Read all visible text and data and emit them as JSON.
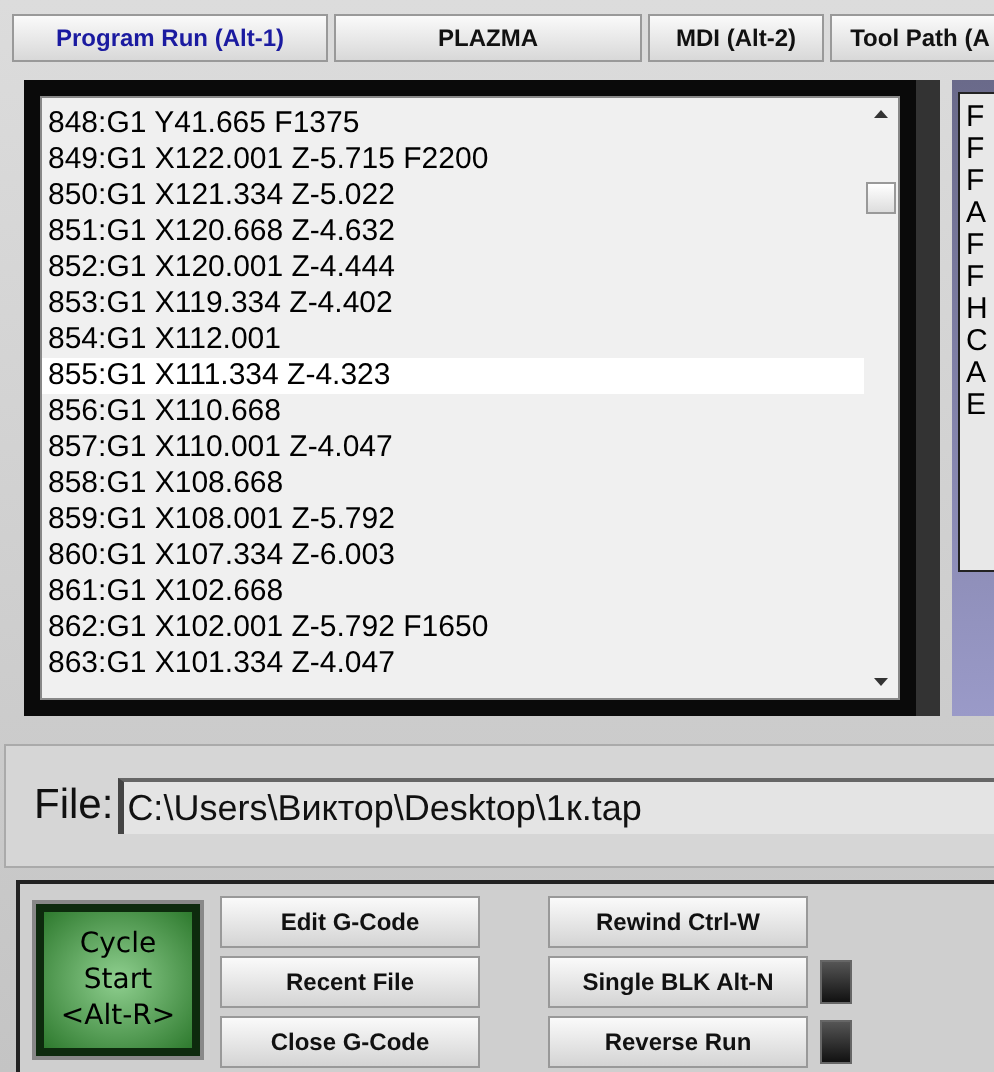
{
  "tabs": [
    {
      "label": "Program Run (Alt-1)",
      "selected": true
    },
    {
      "label": "PLAZMA",
      "selected": false
    },
    {
      "label": "MDI (Alt-2)",
      "selected": false
    },
    {
      "label": "Tool Path (A",
      "selected": false
    }
  ],
  "code_list": {
    "lines": [
      {
        "text": "848:G1 Y41.665 F1375",
        "selected": false
      },
      {
        "text": "849:G1 X122.001 Z-5.715 F2200",
        "selected": false
      },
      {
        "text": "850:G1 X121.334 Z-5.022",
        "selected": false
      },
      {
        "text": "851:G1 X120.668 Z-4.632",
        "selected": false
      },
      {
        "text": "852:G1 X120.001 Z-4.444",
        "selected": false
      },
      {
        "text": "853:G1 X119.334 Z-4.402",
        "selected": false
      },
      {
        "text": "854:G1 X112.001",
        "selected": false
      },
      {
        "text": "855:G1 X111.334 Z-4.323",
        "selected": true
      },
      {
        "text": "856:G1 X110.668",
        "selected": false
      },
      {
        "text": "857:G1 X110.001 Z-4.047",
        "selected": false
      },
      {
        "text": "858:G1 X108.668",
        "selected": false
      },
      {
        "text": "859:G1 X108.001 Z-5.792",
        "selected": false
      },
      {
        "text": "860:G1 X107.334 Z-6.003",
        "selected": false
      },
      {
        "text": "861:G1 X102.668",
        "selected": false
      },
      {
        "text": "862:G1 X102.001 Z-5.792 F1650",
        "selected": false
      },
      {
        "text": "863:G1 X101.334 Z-4.047",
        "selected": false
      }
    ]
  },
  "side_panel": {
    "letters": [
      "F",
      "F",
      "F",
      "A",
      "F",
      "F",
      "H",
      "C",
      "A",
      "E"
    ]
  },
  "file": {
    "label": "File:",
    "value": "C:\\Users\\Виктор\\Desktop\\1к.tap"
  },
  "cycle_start": {
    "label": "Cycle Start",
    "shortcut": "<Alt-R>"
  },
  "buttons_left": [
    "Edit G-Code",
    "Recent File",
    "Close G-Code"
  ],
  "buttons_right": [
    {
      "label": "Rewind Ctrl-W",
      "kind": "plain"
    },
    {
      "label": "Single BLK Alt-N",
      "kind": "led",
      "on": false
    },
    {
      "label": "Reverse Run",
      "kind": "led",
      "on": false
    }
  ]
}
